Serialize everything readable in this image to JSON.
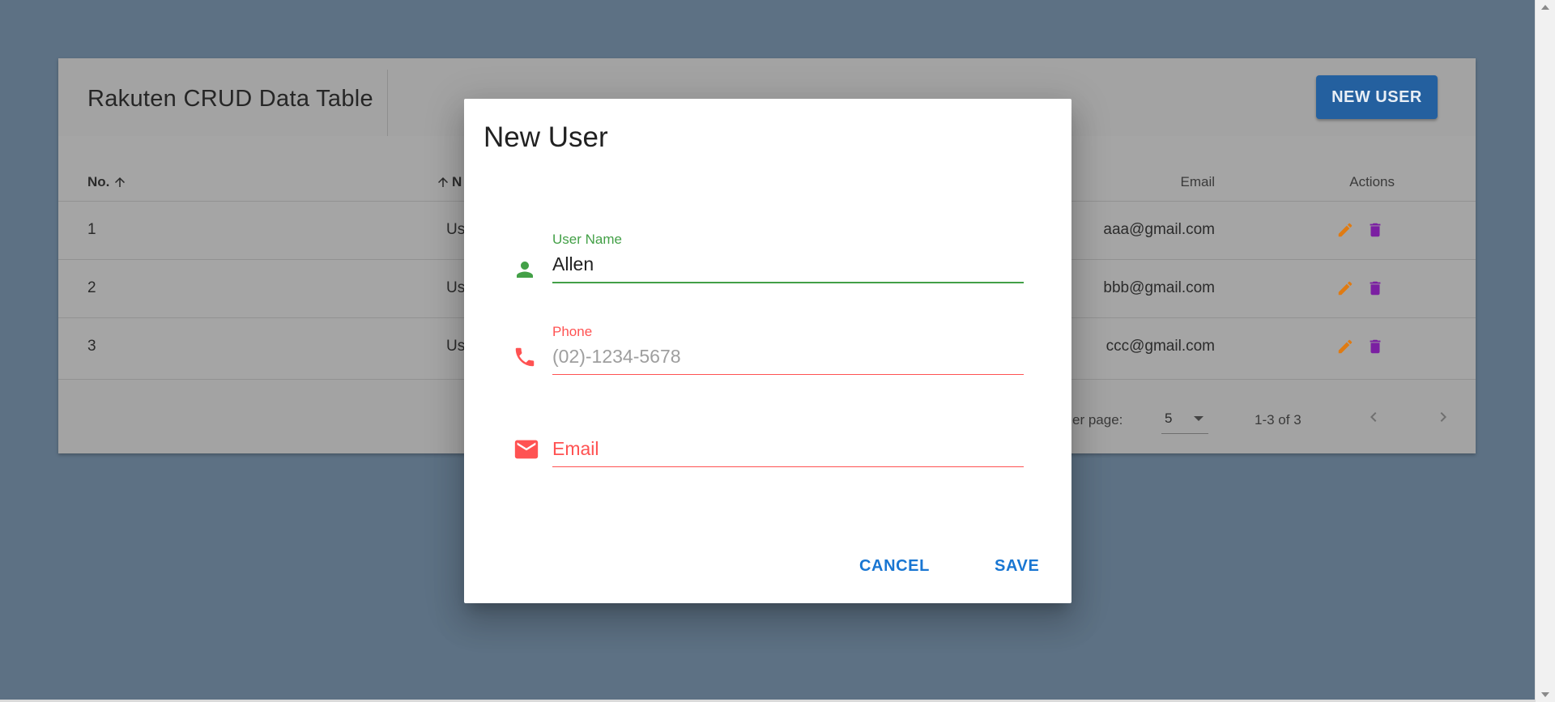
{
  "colors": {
    "overlay": "#5d7184",
    "primary": "#1976d2",
    "new_user_button": "#24609f",
    "success": "#43a047",
    "error": "#ff5252",
    "edit_icon": "#e07b12",
    "delete_icon": "#7b1fa2"
  },
  "page": {
    "title": "Rakuten CRUD Data Table",
    "new_user_label": "NEW USER"
  },
  "table": {
    "headers": {
      "no": "No.",
      "name": "N",
      "email": "Email",
      "actions": "Actions"
    },
    "sort_icon": "arrow-up-icon",
    "rows": [
      {
        "no": "1",
        "name": "Us",
        "email": "aaa@gmail.com"
      },
      {
        "no": "2",
        "name": "Us",
        "email": "bbb@gmail.com"
      },
      {
        "no": "3",
        "name": "Us",
        "email": "ccc@gmail.com"
      }
    ],
    "row_icons": [
      "pencil-icon",
      "trash-icon"
    ]
  },
  "pagination": {
    "rows_per_page_label": "er page:",
    "rows_per_page_value": "5",
    "range": "1-3 of 3"
  },
  "dialog": {
    "title": "New User",
    "fields": {
      "user_name": {
        "label": "User Name",
        "value": "Allen",
        "icon": "person-icon"
      },
      "phone": {
        "label": "Phone",
        "placeholder": "(02)-1234-5678",
        "icon": "phone-icon"
      },
      "email": {
        "placeholder": "Email",
        "icon": "email-icon"
      }
    },
    "cancel_label": "CANCEL",
    "save_label": "SAVE"
  }
}
